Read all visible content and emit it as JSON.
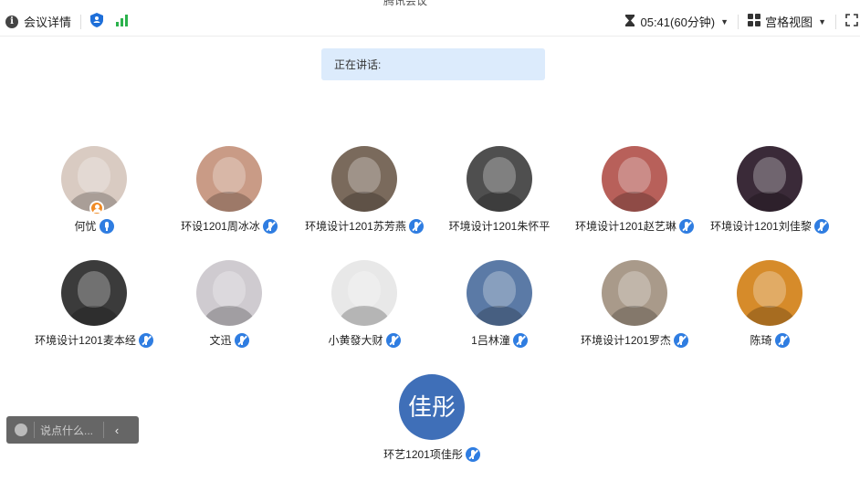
{
  "topbar": {
    "window_title": "腾讯会议",
    "meeting_info_label": "会议详情",
    "timer": "05:41(60分钟)",
    "view_mode_label": "宫格视图",
    "colors": {
      "shield": "#1e6fd9",
      "signal": "#2bb24c"
    }
  },
  "speaking": {
    "label": "正在讲话:"
  },
  "participants": [
    {
      "name": "何忧",
      "row": 1,
      "col": 1,
      "mic": "active",
      "host": true,
      "avatar_bg": "#d9cbc2"
    },
    {
      "name": "环设1201周冰冰",
      "row": 1,
      "col": 2,
      "mic": "muted",
      "host": false,
      "avatar_bg": "#c99b86"
    },
    {
      "name": "环境设计1201苏芳燕",
      "row": 1,
      "col": 3,
      "mic": "muted",
      "host": false,
      "avatar_bg": "#7a6a5c"
    },
    {
      "name": "环境设计1201朱怀平",
      "row": 1,
      "col": 4,
      "mic": "none",
      "host": false,
      "avatar_bg": "#4f4f4f"
    },
    {
      "name": "环境设计1201赵艺琳",
      "row": 1,
      "col": 5,
      "mic": "muted",
      "host": false,
      "avatar_bg": "#b8605a"
    },
    {
      "name": "环境设计1201刘佳黎",
      "row": 1,
      "col": 6,
      "mic": "muted",
      "host": false,
      "avatar_bg": "#3a2a38"
    },
    {
      "name": "环境设计1201麦本经",
      "row": 2,
      "col": 1,
      "mic": "muted",
      "host": false,
      "avatar_bg": "#3b3b3b"
    },
    {
      "name": "文迅",
      "row": 2,
      "col": 2,
      "mic": "muted",
      "host": false,
      "avatar_bg": "#cfcbd0"
    },
    {
      "name": "小黄發大财",
      "row": 2,
      "col": 3,
      "mic": "muted",
      "host": false,
      "avatar_bg": "#e8e8e8"
    },
    {
      "name": "1吕林潼",
      "row": 2,
      "col": 4,
      "mic": "muted",
      "host": false,
      "avatar_bg": "#5b7aa6"
    },
    {
      "name": "环境设计1201罗杰",
      "row": 2,
      "col": 5,
      "mic": "muted",
      "host": false,
      "avatar_bg": "#a99a8a"
    },
    {
      "name": "陈琦",
      "row": 2,
      "col": 6,
      "mic": "muted",
      "host": false,
      "avatar_bg": "#d68b2a"
    },
    {
      "name": "环艺1201项佳彤",
      "row": 3,
      "col": 3.5,
      "mic": "muted",
      "host": false,
      "avatar_bg": "#3f6fb8",
      "avatar_text": "佳彤"
    }
  ],
  "chat": {
    "placeholder": "说点什么...",
    "collapse_icon": "chevron-left-icon"
  }
}
